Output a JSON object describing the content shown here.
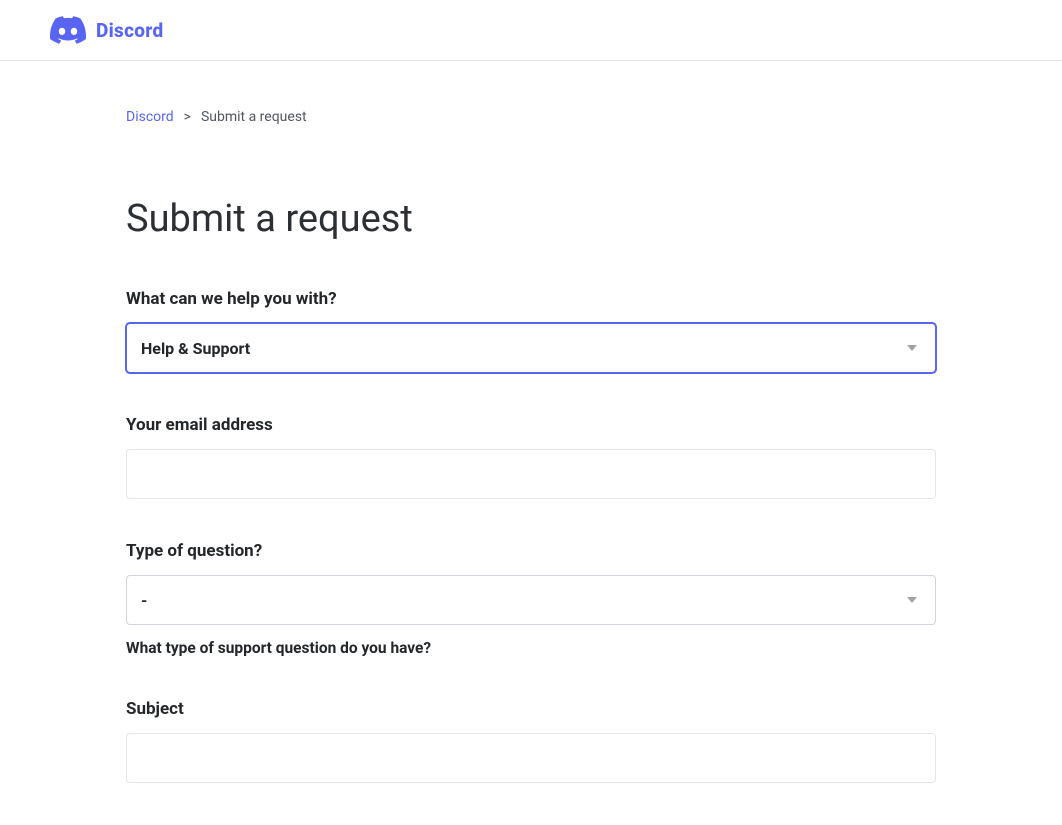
{
  "header": {
    "logo_text": "Discord"
  },
  "breadcrumb": {
    "link_label": "Discord",
    "separator": ">",
    "current": "Submit a request"
  },
  "page": {
    "title": "Submit a request"
  },
  "form": {
    "help_with": {
      "label": "What can we help you with?",
      "selected": "Help & Support"
    },
    "email": {
      "label": "Your email address",
      "value": ""
    },
    "question_type": {
      "label": "Type of question?",
      "selected": "-",
      "hint": "What type of support question do you have?"
    },
    "subject": {
      "label": "Subject",
      "value": ""
    }
  }
}
